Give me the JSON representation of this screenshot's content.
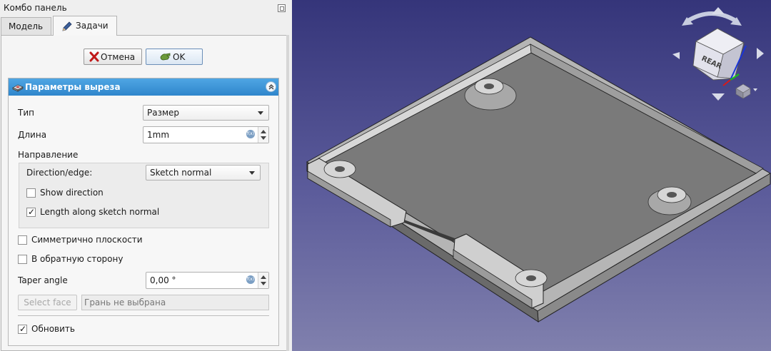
{
  "panel": {
    "title": "Комбо панель",
    "tabs": [
      {
        "label": "Модель",
        "active": false
      },
      {
        "label": "Задачи",
        "active": true
      }
    ]
  },
  "buttons": {
    "cancel": "Отмена",
    "ok": "OK"
  },
  "params": {
    "header": "Параметры выреза",
    "type_label": "Тип",
    "type_value": "Размер",
    "length_label": "Длина",
    "length_value": "1mm",
    "direction_label": "Направление",
    "direction_edge_label": "Direction/edge:",
    "direction_edge_value": "Sketch normal",
    "show_direction_label": "Show direction",
    "show_direction_checked": false,
    "length_along_normal_label": "Length along sketch normal",
    "length_along_normal_checked": true,
    "symmetric_label": "Симметрично плоскости",
    "symmetric_checked": false,
    "reversed_label": "В обратную сторону",
    "reversed_checked": false,
    "taper_label": "Taper angle",
    "taper_value": "0,00 °",
    "select_face_label": "Select face",
    "face_value": "Грань не выбрана",
    "update_label": "Обновить",
    "update_checked": true
  },
  "viewport": {
    "navcube_face": "REAR",
    "background_top": "#35357a",
    "background_bottom": "#8080ad",
    "model_color": "#9a9a9a"
  },
  "icons": {
    "tab_tasks": "pencil-icon",
    "cancel": "red-x-icon",
    "ok": "green-check-hand-icon",
    "params_header": "pocket-feature-icon",
    "collapse": "double-chevron-up-icon",
    "expression": "expression-icon"
  }
}
